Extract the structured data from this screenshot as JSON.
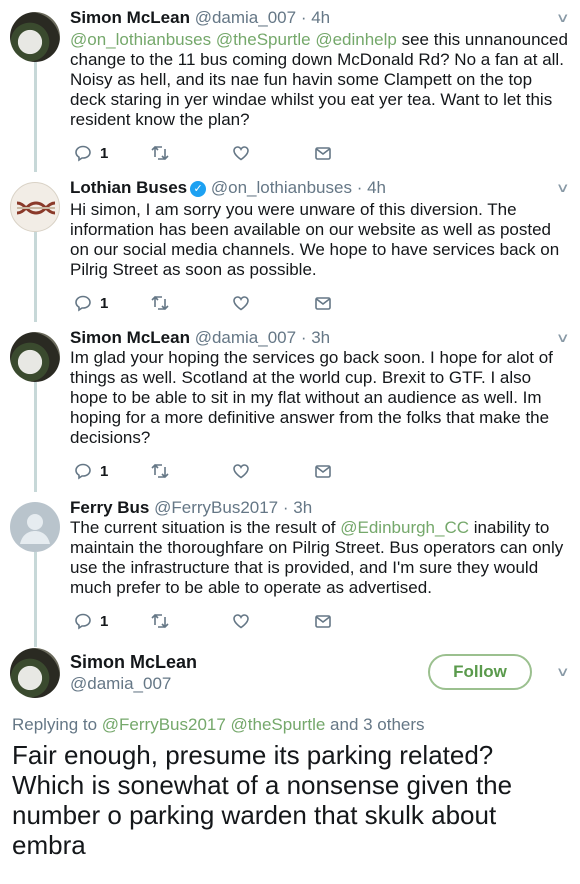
{
  "tweets": [
    {
      "name": "Simon McLean",
      "handle": "@damia_007",
      "time": "· 4h",
      "text_parts": {
        "mention1": "@on_lothianbuses",
        "mention2": "@theSpurtle",
        "mention3": "@edinhelp",
        "body": " see this unnanounced change to the 11 bus coming down McDonald Rd? No a fan at all. Noisy as hell, and its nae fun havin some Clampett on the top deck staring in yer windae whilst you eat yer tea. Want to let this resident know the plan?"
      },
      "reply_count": "1"
    },
    {
      "name": "Lothian Buses",
      "verified": true,
      "handle": "@on_lothianbuses",
      "time": "· 4h",
      "text": "Hi simon, I am sorry you were unware of this diversion. The information has been available on our website as well as posted on our social media channels. We hope to have services back on Pilrig Street as soon as possible.",
      "reply_count": "1"
    },
    {
      "name": "Simon McLean",
      "handle": "@damia_007",
      "time": "· 3h",
      "text": "Im glad your hoping the services go back soon. I hope for alot of things as well. Scotland at the world cup. Brexit to GTF. I also hope to be able to sit in my flat without an audience as well. Im hoping for a more definitive answer from the folks that make the decisions?",
      "reply_count": "1"
    },
    {
      "name": "Ferry Bus",
      "handle": "@FerryBus2017",
      "time": "· 3h",
      "text_parts": {
        "before": "The current situation is the result of ",
        "mention": "@Edinburgh_CC",
        "after": " inability to maintain the thoroughfare on Pilrig Street. Bus operators can only use the infrastructure that is provided, and I'm sure they would much prefer to be able to operate as advertised."
      },
      "reply_count": "1"
    }
  ],
  "main_tweet": {
    "name": "Simon McLean",
    "handle": "@damia_007",
    "follow_label": "Follow",
    "replying_prefix": "Replying to ",
    "replying_mention1": "@FerryBus2017",
    "replying_mention2": "@theSpurtle",
    "replying_suffix": " and 3 others",
    "text": "Fair enough, presume its parking related? Which is sonewhat of a nonsense given the number o parking warden that skulk about embra"
  },
  "colors": {
    "link": "#75a86b",
    "thread_line": "#c7d8d8",
    "secondary_text": "#657786",
    "verified_badge": "#1da1f2"
  },
  "icons": [
    "reply-icon",
    "retweet-icon",
    "like-icon",
    "dm-icon",
    "chevron-down-icon",
    "verified-badge-icon"
  ]
}
